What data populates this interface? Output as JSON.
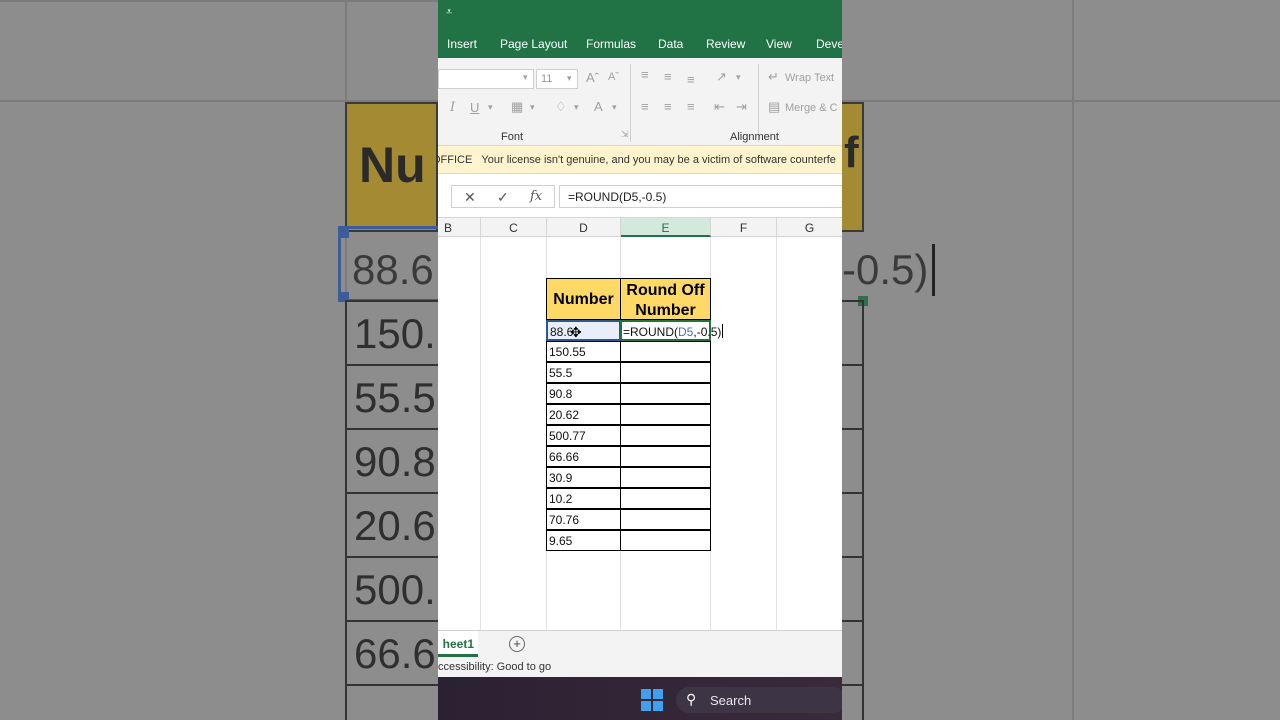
{
  "background": {
    "zoomed_header": "Nu",
    "zoomed_header_right": "f",
    "zoomed_cell": "88.6",
    "zoomed_formula_tail": "-0.5)",
    "zoomed_values": [
      "150.",
      "55.5",
      "90.8",
      "20.6",
      "500.",
      "66.6"
    ]
  },
  "title_bar": {
    "qat_glyph": "⩡"
  },
  "menu": [
    "Insert",
    "Page Layout",
    "Formulas",
    "Data",
    "Review",
    "View",
    "Devel"
  ],
  "ribbon": {
    "font_size": "11",
    "font_group_label": "Font",
    "alignment_group_label": "Alignment",
    "wrap_text": "Wrap Text",
    "merge": "Merge & C"
  },
  "license_bar": {
    "title": "OFFICE",
    "message": "Your license isn't genuine, and you may be a victim of software counterfe"
  },
  "formula_bar": {
    "cancel_glyph": "✕",
    "enter_glyph": "✓",
    "fx_glyph": "fx",
    "formula": "=ROUND(D5,-0.5)"
  },
  "columns": [
    "B",
    "C",
    "D",
    "E",
    "F",
    "G"
  ],
  "selected_column": "E",
  "table": {
    "header_number": "Number",
    "header_round_1": "Round Off",
    "header_round_2": "Number",
    "numbers": [
      "88.6",
      "150.55",
      "55.5",
      "90.8",
      "20.62",
      "500.77",
      "66.66",
      "30.9",
      "10.2",
      "70.76",
      "9.65"
    ],
    "active_cell_visible": "88.6",
    "editing_formula_prefix": "=ROUND(",
    "editing_formula_ref": "D5",
    "editing_formula_suffix": ",-0.5)"
  },
  "sheet_tab": "heet1",
  "add_sheet_glyph": "+",
  "status": "ccessibility: Good to go",
  "taskbar": {
    "search_label": "Search"
  },
  "colors": {
    "excel_green": "#217346",
    "header_fill": "#ffd966",
    "ref_blue": "#4472c4"
  }
}
